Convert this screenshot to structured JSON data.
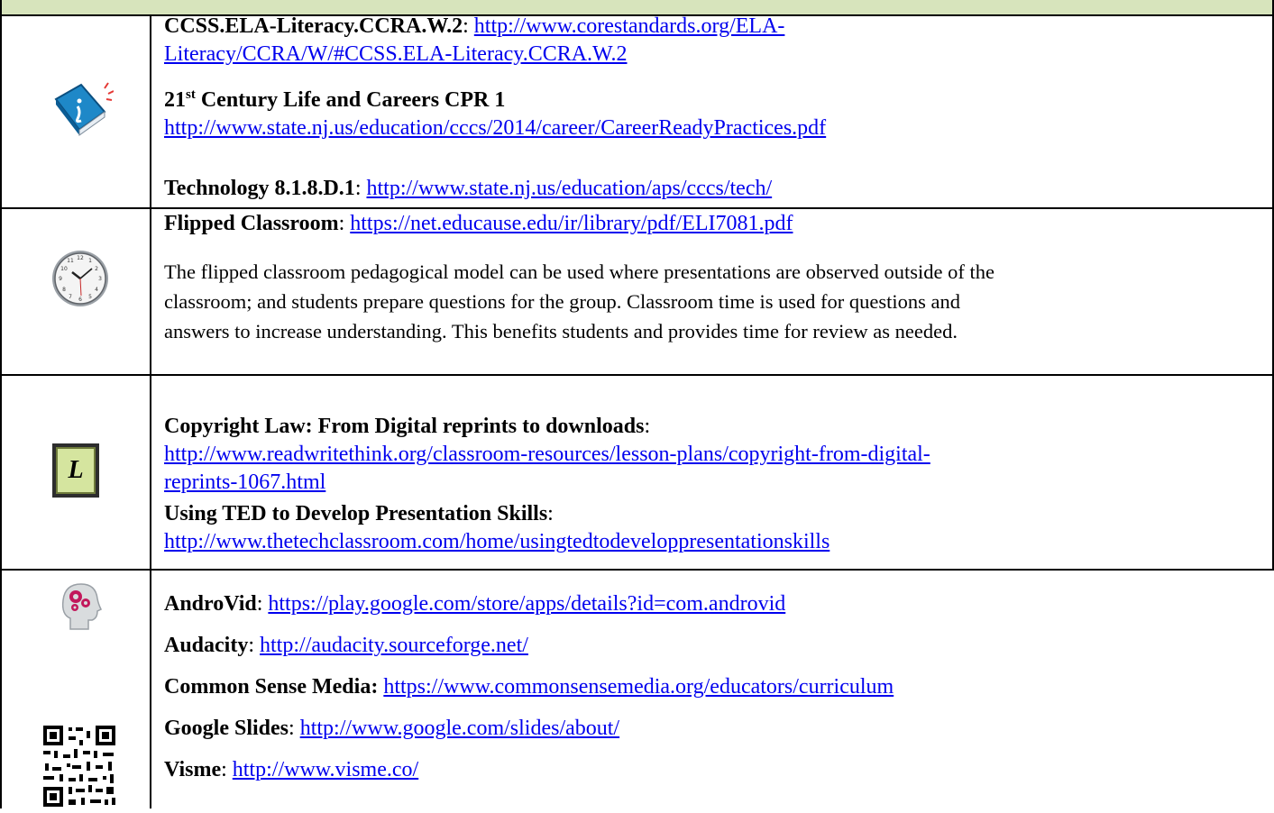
{
  "rows": [
    {
      "icon": "info-book-icon",
      "entries": [
        {
          "title": "CCSS.ELA-Literacy.CCRA.W.2",
          "sep": ": ",
          "link1": "http://www.corestandards.org/ELA-",
          "link2": "Literacy/CCRA/W/#CCSS.ELA-Literacy.CCRA.W.2"
        },
        {
          "title_prefix": "21",
          "title_sup": "st",
          "title_rest": " Century Life and Careers CPR 1",
          "link": "http://www.state.nj.us/education/cccs/2014/career/CareerReadyPractices.pdf"
        },
        {
          "title": "Technology 8.1.8.D.1",
          "sep": ": ",
          "link": "http://www.state.nj.us/education/aps/cccs/tech/"
        }
      ]
    },
    {
      "icon": "clock-icon",
      "entries": [
        {
          "title": "Flipped Classroom",
          "sep": ": ",
          "link": "https://net.educause.edu/ir/library/pdf/ELI7081.pdf"
        },
        {
          "text_lines": [
            "The flipped classroom pedagogical model can be used where presentations are observed outside of the",
            "classroom; and students prepare questions for the group.  Classroom time is used for questions and",
            "answers to increase understanding.  This benefits students and provides time for review as needed."
          ]
        }
      ]
    },
    {
      "icon": "lesson-l-icon",
      "icon_letter": "L",
      "entries": [
        {
          "title": "Copyright Law: From Digital reprints to downloads",
          "sep": ":",
          "link1": "http://www.readwritethink.org/classroom-resources/lesson-plans/copyright-from-digital-",
          "link2": "reprints-1067.html"
        },
        {
          "title": "Using TED to Develop Presentation Skills",
          "sep": ":",
          "link": "http://www.thetechclassroom.com/home/usingtedtodeveloppresentationskills"
        }
      ]
    },
    {
      "icon": "head-gears-icon",
      "icon2": "qr-code-icon",
      "entries": [
        {
          "title": "AndroVid",
          "sep": ": ",
          "link": "https://play.google.com/store/apps/details?id=com.androvid"
        },
        {
          "title": "Audacity",
          "sep": ": ",
          "link": "http://audacity.sourceforge.net/"
        },
        {
          "title": "Common Sense Media:",
          "sep": " ",
          "link": "https://www.commonsensemedia.org/educators/curriculum"
        },
        {
          "title": "Google Slides",
          "sep": ": ",
          "link": "http://www.google.com/slides/about/"
        },
        {
          "title": "Visme",
          "sep": ": ",
          "link": "http://www.visme.co/"
        }
      ]
    }
  ],
  "colors": {
    "header_band": "#d7e4bc",
    "link": "#0000ee",
    "border": "#000000"
  }
}
